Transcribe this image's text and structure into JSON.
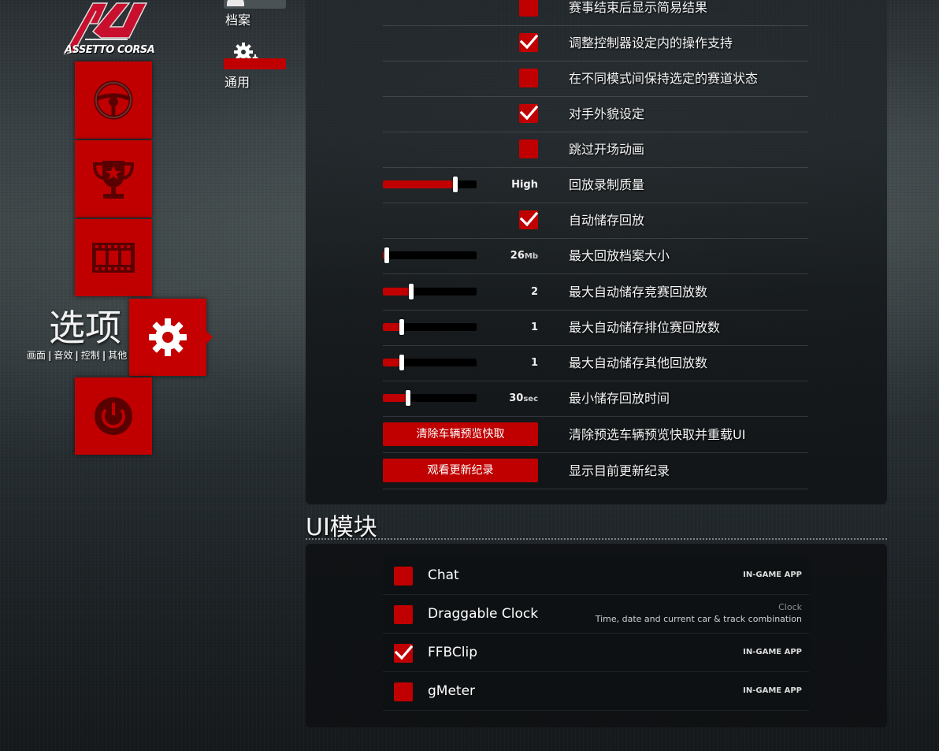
{
  "brand": {
    "logo_text": "ASSETTO CORSA",
    "accent_color": "#c00000"
  },
  "nav": {
    "tiles": [
      {
        "name": "drive",
        "icon": "steering-wheel-icon"
      },
      {
        "name": "career",
        "icon": "trophy-icon"
      },
      {
        "name": "replays",
        "icon": "film-strip-icon"
      },
      {
        "name": "options",
        "icon": "gear-icon",
        "active": true
      },
      {
        "name": "exit",
        "icon": "power-icon"
      }
    ],
    "options_title": "选项",
    "options_sub": [
      "画面",
      "音效",
      "控制",
      "其他"
    ],
    "options_sep": "|"
  },
  "subtabs": [
    {
      "label": "档案",
      "icon": "profile-icon"
    },
    {
      "label": "通用",
      "icon": "gears-icon",
      "active": true
    }
  ],
  "settings": [
    {
      "type": "checkbox",
      "label": "赛事结束后显示简易结果",
      "checked": false
    },
    {
      "type": "checkbox",
      "label": "调整控制器设定内的操作支持",
      "checked": true
    },
    {
      "type": "checkbox",
      "label": "在不同模式间保持选定的赛道状态",
      "checked": false
    },
    {
      "type": "checkbox",
      "label": "对手外貌设定",
      "checked": true
    },
    {
      "type": "checkbox",
      "label": "跳过开场动画",
      "checked": false
    },
    {
      "type": "slider",
      "label": "回放录制质量",
      "value": "High",
      "unit": "",
      "level": 0.77
    },
    {
      "type": "checkbox",
      "label": "自动储存回放",
      "checked": true
    },
    {
      "type": "slider",
      "label": "最大回放档案大小",
      "value": "26",
      "unit": "Mb",
      "level": 0.04
    },
    {
      "type": "slider",
      "label": "最大自动储存竞赛回放数",
      "value": "2",
      "unit": "",
      "level": 0.3
    },
    {
      "type": "slider",
      "label": "最大自动储存排位赛回放数",
      "value": "1",
      "unit": "",
      "level": 0.2
    },
    {
      "type": "slider",
      "label": "最大自动储存其他回放数",
      "value": "1",
      "unit": "",
      "level": 0.2
    },
    {
      "type": "slider",
      "label": "最小储存回放时间",
      "value": "30",
      "unit": "sec",
      "level": 0.27
    },
    {
      "type": "button",
      "label": "清除预选车辆预览快取并重载UI",
      "button": "清除车辆预览快取"
    },
    {
      "type": "button",
      "label": "显示目前更新纪录",
      "button": "观看更新纪录"
    }
  ],
  "ui_modules": {
    "title": "UI模块",
    "items": [
      {
        "name": "Chat",
        "checked": false,
        "tag": "IN-GAME APP"
      },
      {
        "name": "Draggable Clock",
        "checked": false,
        "desc1": "Clock",
        "desc2": "Time, date and current car & track combination"
      },
      {
        "name": "FFBClip",
        "checked": true,
        "tag": "IN-GAME APP"
      },
      {
        "name": "gMeter",
        "checked": false,
        "tag": "IN-GAME APP"
      }
    ]
  }
}
